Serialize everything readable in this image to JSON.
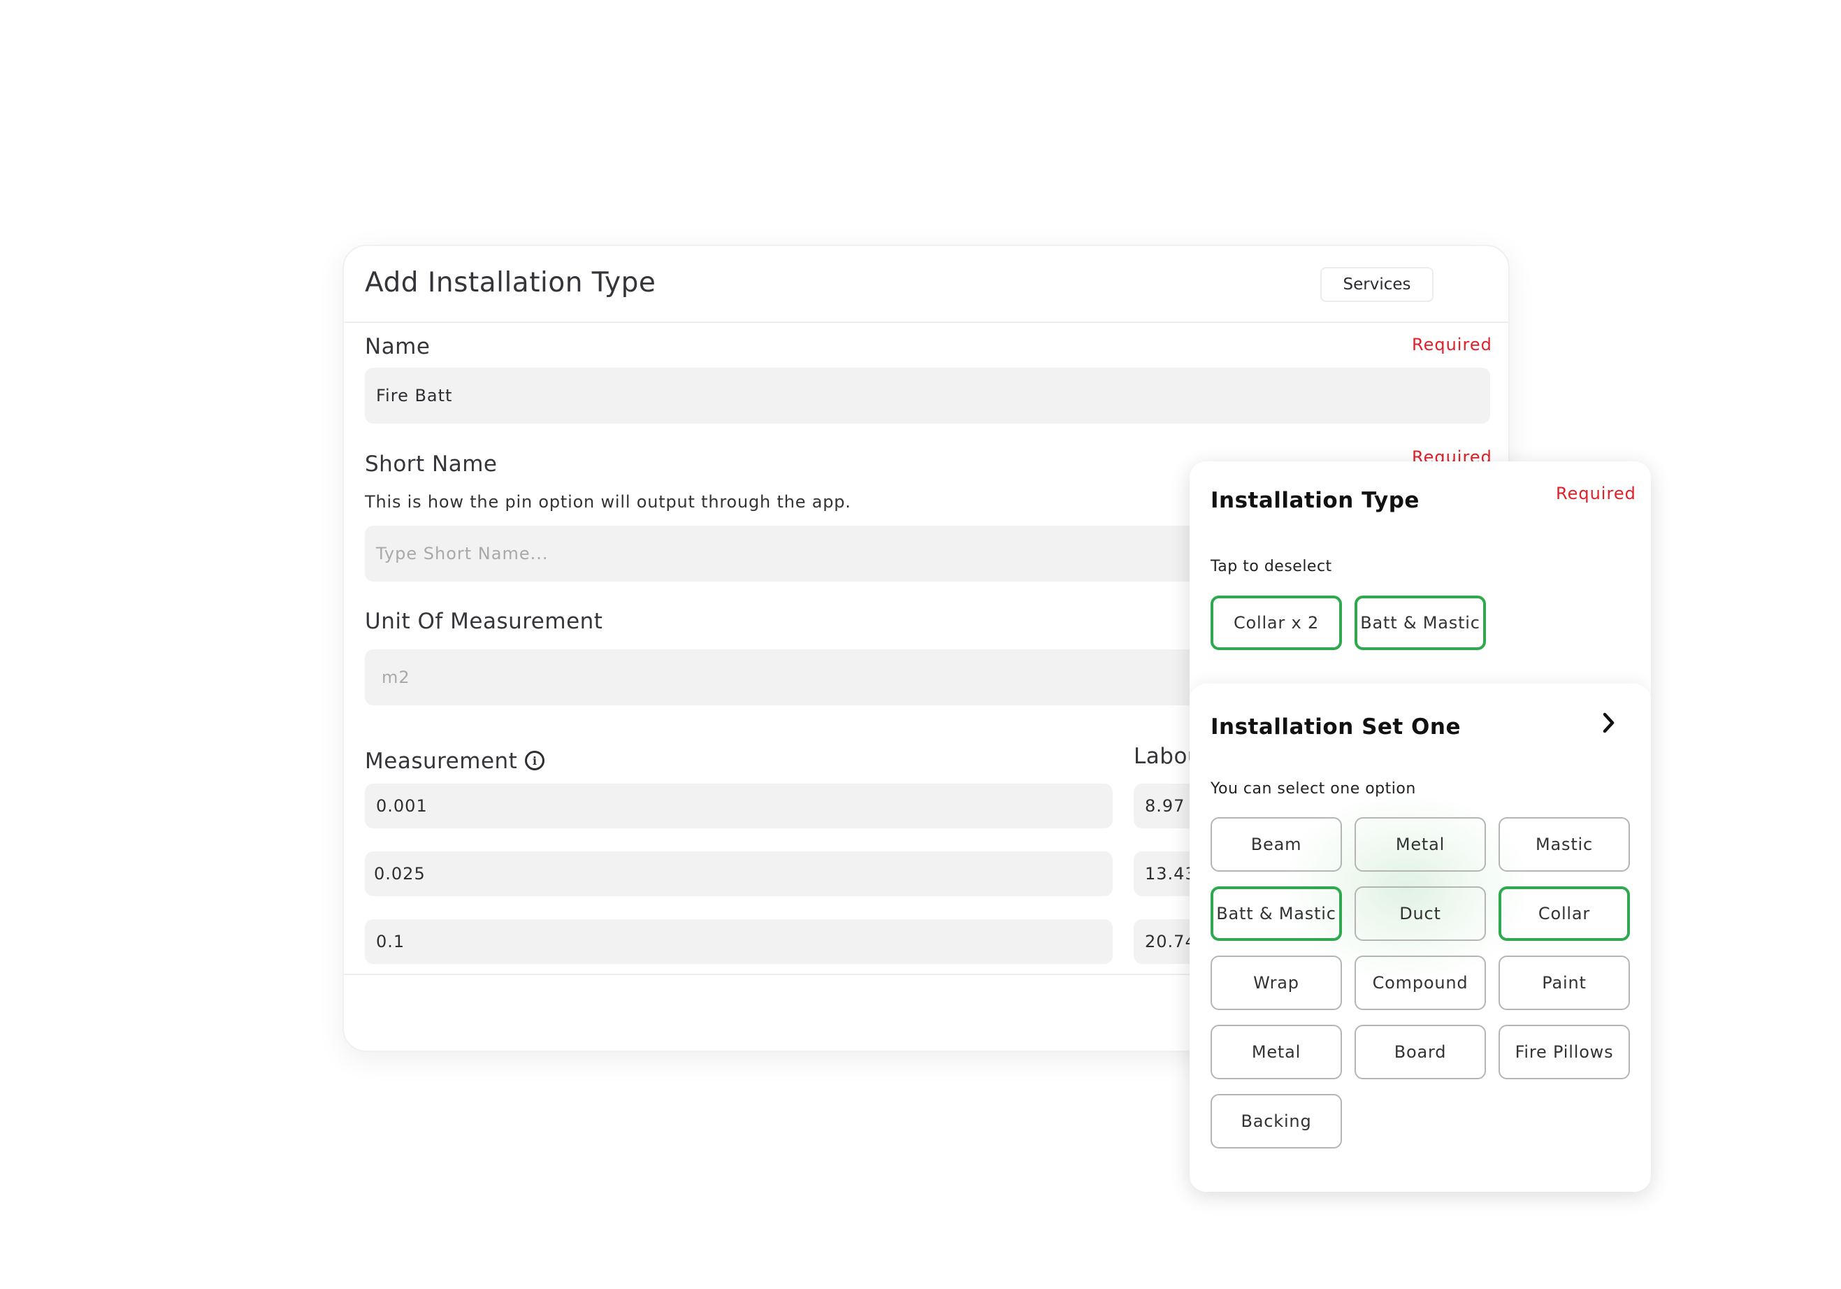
{
  "main": {
    "title": "Add Installation Type",
    "services_label": "Services",
    "name": {
      "label": "Name",
      "required": "Required",
      "value": "Fire Batt"
    },
    "short_name": {
      "label": "Short Name",
      "required": "Required",
      "helper": "This is how the pin option will output through the app.",
      "placeholder": "Type Short Name..."
    },
    "unit": {
      "label": "Unit Of Measurement",
      "value": "m2"
    },
    "measurement": {
      "label": "Measurement",
      "values": [
        "0.001",
        "0.025",
        "0.1"
      ]
    },
    "labour": {
      "label": "Labou",
      "values": [
        "8.97",
        "13.43",
        "20.74"
      ]
    }
  },
  "panel": {
    "title": "Installation Type",
    "required": "Required",
    "tap_hint": "Tap to deselect",
    "selected": [
      "Collar x 2",
      "Batt & Mastic"
    ],
    "set": {
      "title": "Installation Set One",
      "hint": "You can select one option",
      "options": [
        {
          "label": "Beam",
          "selected": false
        },
        {
          "label": "Metal",
          "selected": false
        },
        {
          "label": "Mastic",
          "selected": false
        },
        {
          "label": "Batt & Mastic",
          "selected": true
        },
        {
          "label": "Duct",
          "selected": false
        },
        {
          "label": "Collar",
          "selected": true
        },
        {
          "label": "Wrap",
          "selected": false
        },
        {
          "label": "Compound",
          "selected": false
        },
        {
          "label": "Paint",
          "selected": false
        },
        {
          "label": "Metal",
          "selected": false
        },
        {
          "label": "Board",
          "selected": false
        },
        {
          "label": "Fire Pillows",
          "selected": false
        },
        {
          "label": "Backing",
          "selected": false
        }
      ]
    }
  },
  "colors": {
    "required": "#e0202a",
    "selected_border": "#2fa84f",
    "field_bg": "#f2f2f2"
  }
}
